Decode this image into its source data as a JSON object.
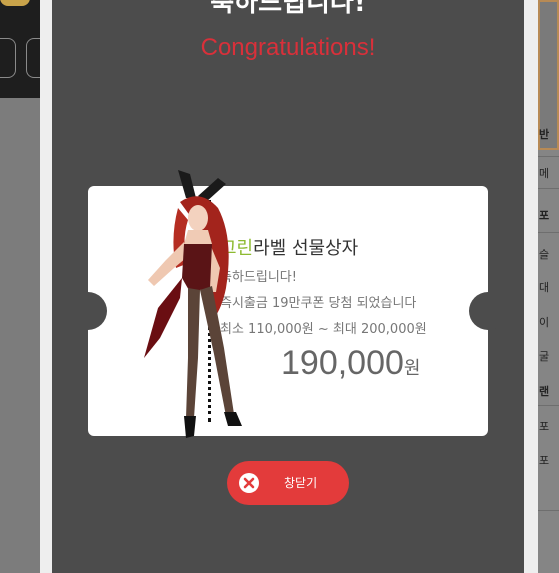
{
  "background": {
    "right_items": [
      "반",
      "메",
      "포",
      "슬",
      "대",
      "이",
      "굴",
      "랜",
      "포",
      "포"
    ]
  },
  "modal": {
    "heading": "축하드립니다!",
    "subheading": "Congratulations!",
    "ticket": {
      "title_accent": "그린",
      "title_rest": "라벨 선물상자",
      "line1": "축하드립니다!",
      "line2": "즉시출금 19만쿠폰 당첨 되었습니다",
      "line3": "최소 110,000원 ~ 최대 200,000원",
      "amount": "190,000",
      "amount_unit": "원"
    },
    "close_button": {
      "label": "창닫기",
      "icon": "close-circle-icon"
    }
  },
  "colors": {
    "overlay": "#4c4c4c",
    "subheading": "#d9303a",
    "title_accent": "#8dba30",
    "close_button": "#e33b3b"
  }
}
